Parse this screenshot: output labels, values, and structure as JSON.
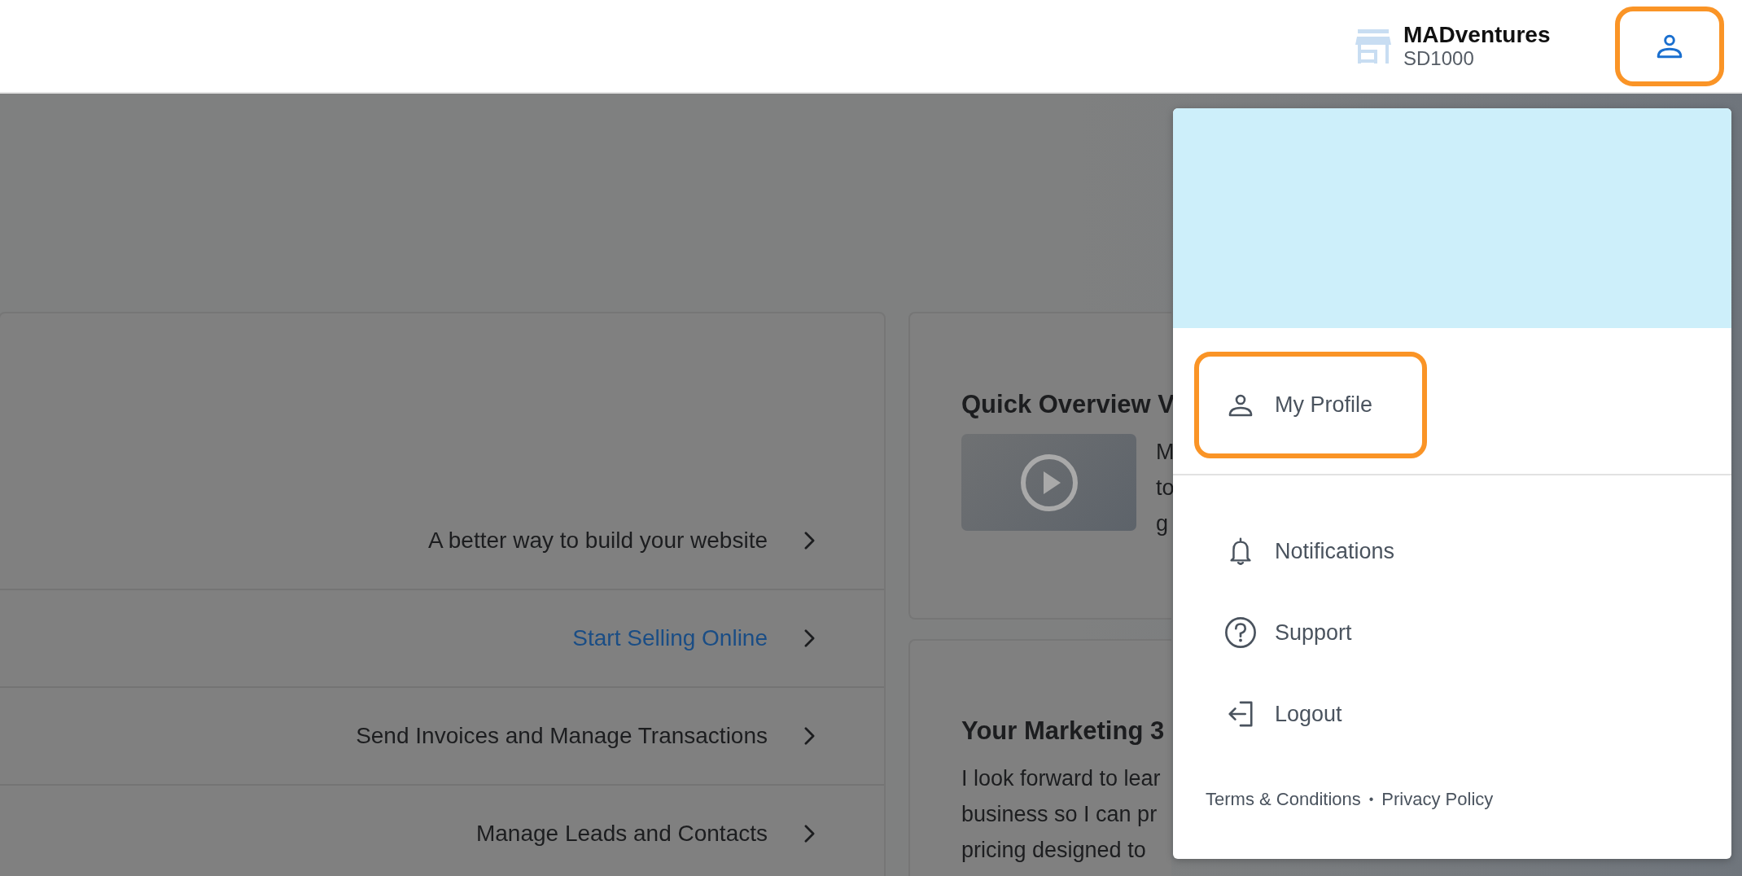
{
  "header": {
    "business_name": "MADventures",
    "business_id": "SD1000",
    "profile_button": {
      "highlighted": true
    }
  },
  "task_list": [
    {
      "label": "A better way to build your website",
      "kind": "text"
    },
    {
      "label": "Start Selling Online",
      "kind": "link"
    },
    {
      "label": "Send Invoices and Manage Transactions",
      "kind": "text"
    },
    {
      "label": "Manage Leads and Contacts",
      "kind": "text"
    }
  ],
  "video_card": {
    "title": "Quick Overview V",
    "text_lines": [
      "M",
      "to",
      "g"
    ]
  },
  "marketing_card": {
    "title": "Your Marketing 3",
    "text_lines": [
      "I look forward to lear",
      "business so I can pr",
      "pricing designed to"
    ]
  },
  "profile_menu": {
    "items": [
      {
        "label": "My Profile",
        "kind": "person",
        "highlighted": true
      },
      {
        "label": "Notifications",
        "kind": "bell",
        "highlighted": false
      },
      {
        "label": "Support",
        "kind": "help",
        "highlighted": false
      },
      {
        "label": "Logout",
        "kind": "logout",
        "highlighted": false
      }
    ],
    "footer_links": [
      "Terms & Conditions",
      "Privacy Policy"
    ],
    "footer_separator": "•"
  }
}
